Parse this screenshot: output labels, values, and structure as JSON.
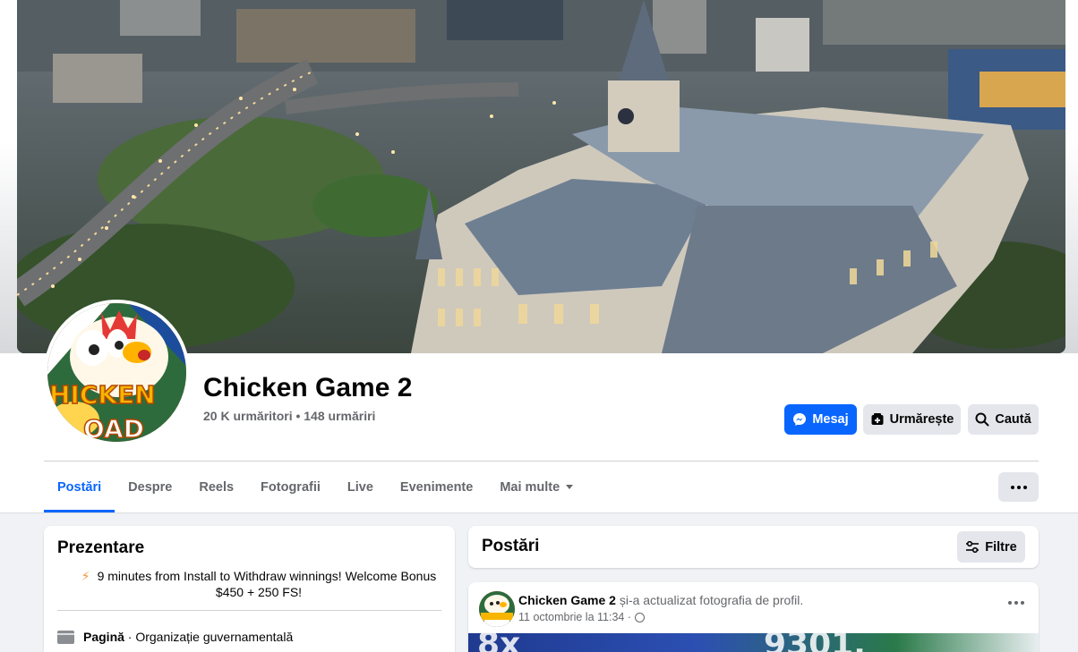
{
  "page": {
    "name": "Chicken Game 2",
    "stats": "20 K urmăritori • 148 urmăriri"
  },
  "actions": {
    "message": "Mesaj",
    "follow": "Urmărește",
    "search": "Caută"
  },
  "tabs": [
    "Postări",
    "Despre",
    "Reels",
    "Fotografii",
    "Live",
    "Evenimente",
    "Mai multe"
  ],
  "active_tab": "Postări",
  "intro": {
    "title": "Prezentare",
    "bio": "9 minutes from Install to Withdraw winnings! Welcome Bonus $450 + 250 FS!",
    "category_label": "Pagină",
    "category_value": " · Organizație guvernamentală"
  },
  "posts": {
    "title": "Postări",
    "filter": "Filtre"
  },
  "post": {
    "author": "Chicken Game 2",
    "action": " și-a actualizat fotografia de profil.",
    "date": "11 octombrie la 11:34 ·"
  },
  "colors": {
    "accent": "#0866ff",
    "secondary_button": "#e4e6eb",
    "background": "#f0f2f5"
  },
  "icons": [
    "messenger-icon",
    "follow-icon",
    "search-icon",
    "ellipsis-icon",
    "filter-icon",
    "globe-icon",
    "bolt-icon",
    "category-icon"
  ]
}
